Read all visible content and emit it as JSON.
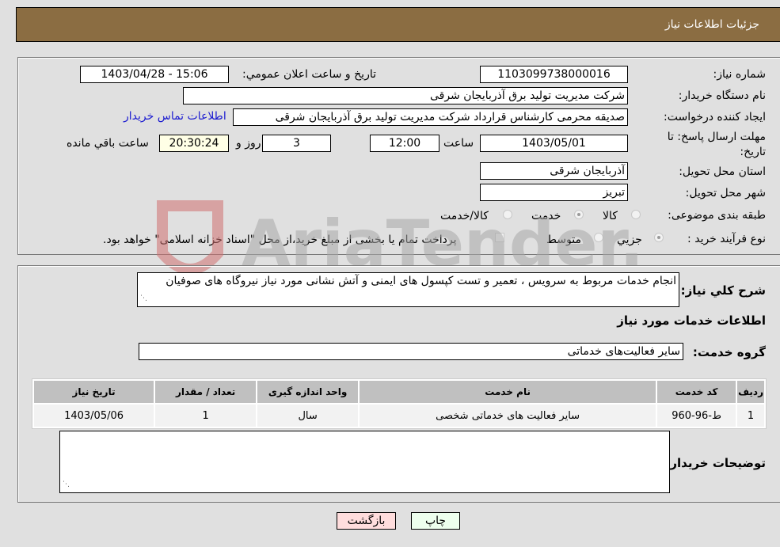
{
  "header": {
    "title": "جزئیات اطلاعات نیاز"
  },
  "form": {
    "need_number": {
      "label": "شماره نیاز:",
      "value": "1103099738000016"
    },
    "announce_datetime": {
      "label": "تاریخ و ساعت اعلان عمومي:",
      "value": "1403/04/28 - 15:06"
    },
    "buyer_org": {
      "label": "نام دستگاه خریدار:",
      "value": "شرکت مدیریت تولید برق آذربایجان شرقی"
    },
    "requester": {
      "label": "ایجاد کننده درخواست:",
      "value": "صدیقه محرمی کارشناس قرارداد شرکت مدیریت تولید برق آذربایجان شرقی"
    },
    "buyer_contact_link": "اطلاعات تماس خریدار",
    "deadline": {
      "label": "مهلت ارسال پاسخ: تا تاریخ:",
      "date": "1403/05/01",
      "time_label": "ساعت",
      "time": "12:00",
      "days": "3",
      "days_label": "روز و",
      "remaining": "20:30:24",
      "remaining_label": "ساعت باقي مانده"
    },
    "province": {
      "label": "استان محل تحویل:",
      "value": "آذربایجان شرقی"
    },
    "city": {
      "label": "شهر محل تحویل:",
      "value": "تبریز"
    },
    "category": {
      "label": "طبقه بندی موضوعی:",
      "options": [
        "کالا",
        "خدمت",
        "کالا/خدمت"
      ],
      "selected": "خدمت"
    },
    "purchase_type": {
      "label": "نوع فرآیند خرید :",
      "options": [
        "جزيي",
        "متوسط"
      ],
      "selected": "جزيي",
      "treasury_checkbox_label": "پرداخت تمام یا بخشی از مبلغ خرید،از محل \"اسناد خزانه اسلامی\" خواهد بود.",
      "treasury_checked": false
    }
  },
  "details": {
    "summary_label": "شرح کلي نیاز:",
    "summary_value": "انجام خدمات مربوط به سرویس ، تعمیر و تست کپسول های ایمنی و آتش نشانی مورد نیاز نیروگاه های صوفیان",
    "services_heading": "اطلاعات خدمات مورد نیاز",
    "service_group_label": "گروه خدمت:",
    "service_group_value": "سایر فعالیت‌های خدماتی",
    "table": {
      "headers": [
        "ردیف",
        "کد خدمت",
        "نام خدمت",
        "واحد اندازه گیری",
        "تعداد / مقدار",
        "تاریخ نیاز"
      ],
      "rows": [
        [
          "1",
          "ط-96-960",
          "سایر فعالیت های خدماتی شخصی",
          "سال",
          "1",
          "1403/05/06"
        ]
      ]
    },
    "buyer_notes_label": "توضیحات خریدار:",
    "buyer_notes_value": ""
  },
  "buttons": {
    "print": "چاپ",
    "back": "بازگشت"
  },
  "watermark": {
    "text": "AriaTender.neT"
  }
}
